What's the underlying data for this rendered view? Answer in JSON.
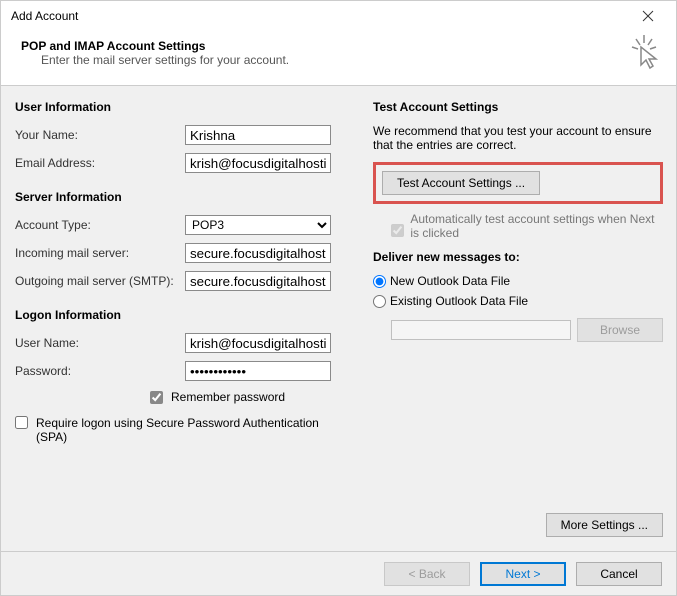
{
  "title": "Add Account",
  "header": {
    "title": "POP and IMAP Account Settings",
    "subtitle": "Enter the mail server settings for your account."
  },
  "left": {
    "userInfoTitle": "User Information",
    "yourNameLabel": "Your Name:",
    "yourNameValue": "Krishna",
    "emailLabel": "Email Address:",
    "emailValue": "krish@focusdigitalhosting.com",
    "serverInfoTitle": "Server Information",
    "accountTypeLabel": "Account Type:",
    "accountTypeValue": "POP3",
    "incomingLabel": "Incoming mail server:",
    "incomingValue": "secure.focusdigitalhosting.com",
    "outgoingLabel": "Outgoing mail server (SMTP):",
    "outgoingValue": "secure.focusdigitalhosting.com",
    "logonTitle": "Logon Information",
    "usernameLabel": "User Name:",
    "usernameValue": "krish@focusdigitalhosting.com",
    "passwordLabel": "Password:",
    "passwordValue": "************",
    "rememberLabel": "Remember password",
    "spaLabel": "Require logon using Secure Password Authentication (SPA)"
  },
  "right": {
    "testTitle": "Test Account Settings",
    "testText": "We recommend that you test your account to ensure that the entries are correct.",
    "testButton": "Test Account Settings ...",
    "autoTestLabel": "Automatically test account settings when Next is clicked",
    "deliverTitle": "Deliver new messages to:",
    "newDataFile": "New Outlook Data File",
    "existingDataFile": "Existing Outlook Data File",
    "browse": "Browse",
    "moreSettings": "More Settings ..."
  },
  "footer": {
    "back": "< Back",
    "next": "Next >",
    "cancel": "Cancel"
  }
}
